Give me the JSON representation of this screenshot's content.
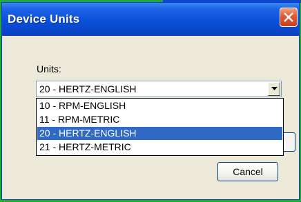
{
  "window": {
    "title": "Device Units",
    "title_color": "#0a4fd8",
    "close_icon": "close-icon"
  },
  "form": {
    "units_label": "Units:",
    "selected_value": "20 - HERTZ-ENGLISH",
    "dropdown_arrow_icon": "chevron-down-icon"
  },
  "dropdown": {
    "options": [
      "10 - RPM-ENGLISH",
      "11 - RPM-METRIC",
      "20 - HERTZ-ENGLISH",
      "21 - HERTZ-METRIC"
    ],
    "highlighted": "20 - HERTZ-ENGLISH",
    "highlight_color": "#316ac5"
  },
  "buttons": {
    "ok_label": "",
    "cancel_label": "Cancel"
  }
}
